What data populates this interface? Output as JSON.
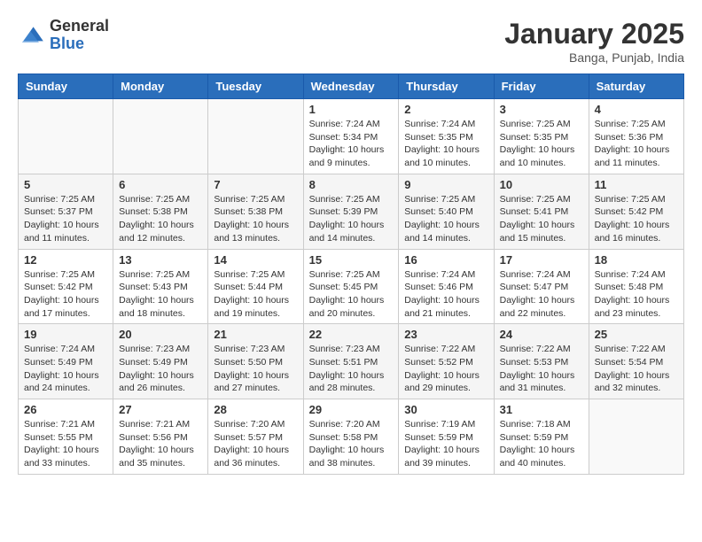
{
  "header": {
    "logo_general": "General",
    "logo_blue": "Blue",
    "month_title": "January 2025",
    "location": "Banga, Punjab, India"
  },
  "weekdays": [
    "Sunday",
    "Monday",
    "Tuesday",
    "Wednesday",
    "Thursday",
    "Friday",
    "Saturday"
  ],
  "weeks": [
    [
      {
        "day": "",
        "info": ""
      },
      {
        "day": "",
        "info": ""
      },
      {
        "day": "",
        "info": ""
      },
      {
        "day": "1",
        "info": "Sunrise: 7:24 AM\nSunset: 5:34 PM\nDaylight: 10 hours and 9 minutes."
      },
      {
        "day": "2",
        "info": "Sunrise: 7:24 AM\nSunset: 5:35 PM\nDaylight: 10 hours and 10 minutes."
      },
      {
        "day": "3",
        "info": "Sunrise: 7:25 AM\nSunset: 5:35 PM\nDaylight: 10 hours and 10 minutes."
      },
      {
        "day": "4",
        "info": "Sunrise: 7:25 AM\nSunset: 5:36 PM\nDaylight: 10 hours and 11 minutes."
      }
    ],
    [
      {
        "day": "5",
        "info": "Sunrise: 7:25 AM\nSunset: 5:37 PM\nDaylight: 10 hours and 11 minutes."
      },
      {
        "day": "6",
        "info": "Sunrise: 7:25 AM\nSunset: 5:38 PM\nDaylight: 10 hours and 12 minutes."
      },
      {
        "day": "7",
        "info": "Sunrise: 7:25 AM\nSunset: 5:38 PM\nDaylight: 10 hours and 13 minutes."
      },
      {
        "day": "8",
        "info": "Sunrise: 7:25 AM\nSunset: 5:39 PM\nDaylight: 10 hours and 14 minutes."
      },
      {
        "day": "9",
        "info": "Sunrise: 7:25 AM\nSunset: 5:40 PM\nDaylight: 10 hours and 14 minutes."
      },
      {
        "day": "10",
        "info": "Sunrise: 7:25 AM\nSunset: 5:41 PM\nDaylight: 10 hours and 15 minutes."
      },
      {
        "day": "11",
        "info": "Sunrise: 7:25 AM\nSunset: 5:42 PM\nDaylight: 10 hours and 16 minutes."
      }
    ],
    [
      {
        "day": "12",
        "info": "Sunrise: 7:25 AM\nSunset: 5:42 PM\nDaylight: 10 hours and 17 minutes."
      },
      {
        "day": "13",
        "info": "Sunrise: 7:25 AM\nSunset: 5:43 PM\nDaylight: 10 hours and 18 minutes."
      },
      {
        "day": "14",
        "info": "Sunrise: 7:25 AM\nSunset: 5:44 PM\nDaylight: 10 hours and 19 minutes."
      },
      {
        "day": "15",
        "info": "Sunrise: 7:25 AM\nSunset: 5:45 PM\nDaylight: 10 hours and 20 minutes."
      },
      {
        "day": "16",
        "info": "Sunrise: 7:24 AM\nSunset: 5:46 PM\nDaylight: 10 hours and 21 minutes."
      },
      {
        "day": "17",
        "info": "Sunrise: 7:24 AM\nSunset: 5:47 PM\nDaylight: 10 hours and 22 minutes."
      },
      {
        "day": "18",
        "info": "Sunrise: 7:24 AM\nSunset: 5:48 PM\nDaylight: 10 hours and 23 minutes."
      }
    ],
    [
      {
        "day": "19",
        "info": "Sunrise: 7:24 AM\nSunset: 5:49 PM\nDaylight: 10 hours and 24 minutes."
      },
      {
        "day": "20",
        "info": "Sunrise: 7:23 AM\nSunset: 5:49 PM\nDaylight: 10 hours and 26 minutes."
      },
      {
        "day": "21",
        "info": "Sunrise: 7:23 AM\nSunset: 5:50 PM\nDaylight: 10 hours and 27 minutes."
      },
      {
        "day": "22",
        "info": "Sunrise: 7:23 AM\nSunset: 5:51 PM\nDaylight: 10 hours and 28 minutes."
      },
      {
        "day": "23",
        "info": "Sunrise: 7:22 AM\nSunset: 5:52 PM\nDaylight: 10 hours and 29 minutes."
      },
      {
        "day": "24",
        "info": "Sunrise: 7:22 AM\nSunset: 5:53 PM\nDaylight: 10 hours and 31 minutes."
      },
      {
        "day": "25",
        "info": "Sunrise: 7:22 AM\nSunset: 5:54 PM\nDaylight: 10 hours and 32 minutes."
      }
    ],
    [
      {
        "day": "26",
        "info": "Sunrise: 7:21 AM\nSunset: 5:55 PM\nDaylight: 10 hours and 33 minutes."
      },
      {
        "day": "27",
        "info": "Sunrise: 7:21 AM\nSunset: 5:56 PM\nDaylight: 10 hours and 35 minutes."
      },
      {
        "day": "28",
        "info": "Sunrise: 7:20 AM\nSunset: 5:57 PM\nDaylight: 10 hours and 36 minutes."
      },
      {
        "day": "29",
        "info": "Sunrise: 7:20 AM\nSunset: 5:58 PM\nDaylight: 10 hours and 38 minutes."
      },
      {
        "day": "30",
        "info": "Sunrise: 7:19 AM\nSunset: 5:59 PM\nDaylight: 10 hours and 39 minutes."
      },
      {
        "day": "31",
        "info": "Sunrise: 7:18 AM\nSunset: 5:59 PM\nDaylight: 10 hours and 40 minutes."
      },
      {
        "day": "",
        "info": ""
      }
    ]
  ]
}
